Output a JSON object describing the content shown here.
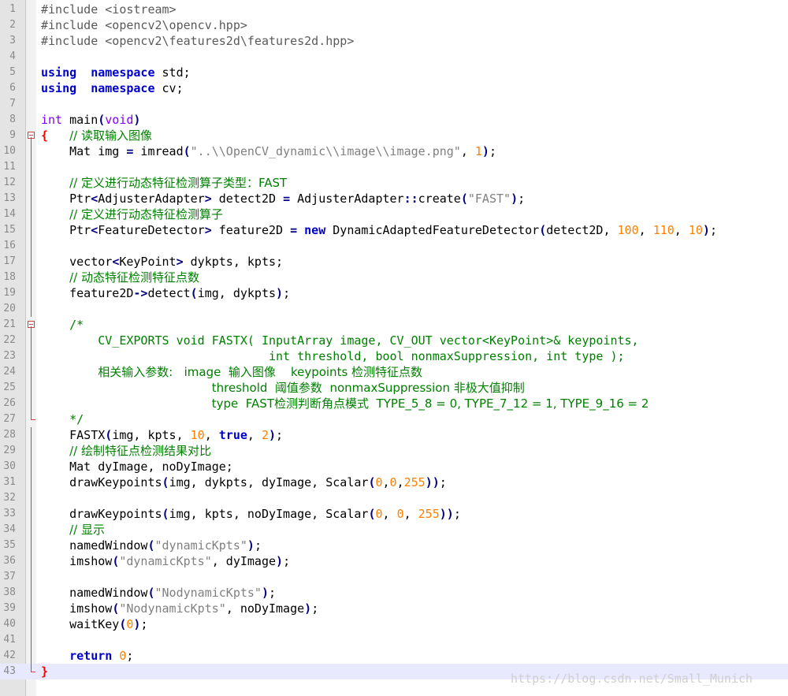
{
  "editor": {
    "watermark": "https://blog.csdn.net/Small_Munich",
    "lines": [
      {
        "n": "1",
        "t": [
          [
            "pp",
            "#include <iostream>"
          ]
        ]
      },
      {
        "n": "2",
        "t": [
          [
            "pp",
            "#include <opencv2\\opencv.hpp>"
          ]
        ]
      },
      {
        "n": "3",
        "t": [
          [
            "pp",
            "#include <opencv2\\features2d\\features2d.hpp>"
          ]
        ]
      },
      {
        "n": "4",
        "t": []
      },
      {
        "n": "5",
        "t": [
          [
            "kw",
            "using"
          ],
          [
            "",
            "  "
          ],
          [
            "kw",
            "namespace"
          ],
          [
            "",
            " std;"
          ]
        ]
      },
      {
        "n": "6",
        "t": [
          [
            "kw",
            "using"
          ],
          [
            "",
            "  "
          ],
          [
            "kw",
            "namespace"
          ],
          [
            "",
            " cv;"
          ]
        ]
      },
      {
        "n": "7",
        "t": []
      },
      {
        "n": "8",
        "t": [
          [
            "ty",
            "int"
          ],
          [
            "",
            " main"
          ],
          [
            "op",
            "("
          ],
          [
            "ty",
            "void"
          ],
          [
            "op",
            ")"
          ]
        ]
      },
      {
        "n": "9",
        "t": [
          [
            "br",
            "{"
          ],
          [
            "",
            "   "
          ],
          [
            "cm",
            "// 读取输入图像"
          ]
        ]
      },
      {
        "n": "10",
        "t": [
          [
            "",
            "    Mat img "
          ],
          [
            "op",
            "="
          ],
          [
            "",
            " imread"
          ],
          [
            "op",
            "("
          ],
          [
            "st",
            "\"..\\\\OpenCV_dynamic\\\\image\\\\image.png\""
          ],
          [
            "",
            ", "
          ],
          [
            "nm",
            "1"
          ],
          [
            "op",
            ")"
          ],
          [
            "",
            ";"
          ]
        ]
      },
      {
        "n": "11",
        "t": []
      },
      {
        "n": "12",
        "t": [
          [
            "",
            "    "
          ],
          [
            "cm",
            "// 定义进行动态特征检测算子类型：FAST"
          ]
        ]
      },
      {
        "n": "13",
        "t": [
          [
            "",
            "    Ptr"
          ],
          [
            "op",
            "<"
          ],
          [
            "",
            "AdjusterAdapter"
          ],
          [
            "op",
            ">"
          ],
          [
            "",
            " detect2D "
          ],
          [
            "op",
            "="
          ],
          [
            "",
            " AdjusterAdapter"
          ],
          [
            "op",
            "::"
          ],
          [
            "",
            "create"
          ],
          [
            "op",
            "("
          ],
          [
            "st",
            "\"FAST\""
          ],
          [
            "op",
            ")"
          ],
          [
            "",
            ";"
          ]
        ]
      },
      {
        "n": "14",
        "t": [
          [
            "",
            "    "
          ],
          [
            "cm",
            "// 定义进行动态特征检测算子"
          ]
        ]
      },
      {
        "n": "15",
        "t": [
          [
            "",
            "    Ptr"
          ],
          [
            "op",
            "<"
          ],
          [
            "",
            "FeatureDetector"
          ],
          [
            "op",
            ">"
          ],
          [
            "",
            " feature2D "
          ],
          [
            "op",
            "="
          ],
          [
            "",
            " "
          ],
          [
            "kw",
            "new"
          ],
          [
            "",
            " DynamicAdaptedFeatureDetector"
          ],
          [
            "op",
            "("
          ],
          [
            "",
            "detect2D, "
          ],
          [
            "nm",
            "100"
          ],
          [
            "",
            ", "
          ],
          [
            "nm",
            "110"
          ],
          [
            "",
            ", "
          ],
          [
            "nm",
            "10"
          ],
          [
            "op",
            ")"
          ],
          [
            "",
            ";"
          ]
        ]
      },
      {
        "n": "16",
        "t": []
      },
      {
        "n": "17",
        "t": [
          [
            "",
            "    vector"
          ],
          [
            "op",
            "<"
          ],
          [
            "",
            "KeyPoint"
          ],
          [
            "op",
            ">"
          ],
          [
            "",
            " dykpts, kpts;"
          ]
        ]
      },
      {
        "n": "18",
        "t": [
          [
            "",
            "    "
          ],
          [
            "cm",
            "// 动态特征检测特征点数"
          ]
        ]
      },
      {
        "n": "19",
        "t": [
          [
            "",
            "    feature2D"
          ],
          [
            "op",
            "->"
          ],
          [
            "",
            "detect"
          ],
          [
            "op",
            "("
          ],
          [
            "",
            "img, dykpts"
          ],
          [
            "op",
            ")"
          ],
          [
            "",
            ";"
          ]
        ]
      },
      {
        "n": "20",
        "t": []
      },
      {
        "n": "21",
        "t": [
          [
            "",
            "    "
          ],
          [
            "cm",
            "/*"
          ]
        ]
      },
      {
        "n": "22",
        "t": [
          [
            "",
            "        "
          ],
          [
            "cm",
            "CV_EXPORTS void FASTX( InputArray image, CV_OUT vector<KeyPoint>& keypoints,"
          ]
        ]
      },
      {
        "n": "23",
        "t": [
          [
            "",
            "                                "
          ],
          [
            "cm",
            "int threshold, bool nonmaxSuppression, int type );"
          ]
        ]
      },
      {
        "n": "24",
        "t": [
          [
            "",
            "        "
          ],
          [
            "cm",
            "相关输入参数:   image  输入图像    keypoints 检测特征点数"
          ]
        ]
      },
      {
        "n": "25",
        "t": [
          [
            "",
            "                        "
          ],
          [
            "cm",
            "threshold  阈值参数  nonmaxSuppression 非极大值抑制"
          ]
        ]
      },
      {
        "n": "26",
        "t": [
          [
            "",
            "                        "
          ],
          [
            "cm",
            "type  FAST检测判断角点模式  TYPE_5_8 = 0, TYPE_7_12 = 1, TYPE_9_16 = 2"
          ]
        ]
      },
      {
        "n": "27",
        "t": [
          [
            "",
            "    "
          ],
          [
            "cm",
            "*/"
          ]
        ]
      },
      {
        "n": "28",
        "t": [
          [
            "",
            "    FASTX"
          ],
          [
            "op",
            "("
          ],
          [
            "",
            "img, kpts, "
          ],
          [
            "nm",
            "10"
          ],
          [
            "",
            ", "
          ],
          [
            "kw",
            "true"
          ],
          [
            "",
            ", "
          ],
          [
            "nm",
            "2"
          ],
          [
            "op",
            ")"
          ],
          [
            "",
            ";"
          ]
        ]
      },
      {
        "n": "29",
        "t": [
          [
            "",
            "    "
          ],
          [
            "cm",
            "// 绘制特征点检测结果对比"
          ]
        ]
      },
      {
        "n": "30",
        "t": [
          [
            "",
            "    Mat dyImage, noDyImage;"
          ]
        ]
      },
      {
        "n": "31",
        "t": [
          [
            "",
            "    drawKeypoints"
          ],
          [
            "op",
            "("
          ],
          [
            "",
            "img, dykpts, dyImage, Scalar"
          ],
          [
            "op",
            "("
          ],
          [
            "nm",
            "0"
          ],
          [
            "",
            ","
          ],
          [
            "nm",
            "0"
          ],
          [
            "",
            ","
          ],
          [
            "nm",
            "255"
          ],
          [
            "op",
            "))"
          ],
          [
            "",
            ";"
          ]
        ]
      },
      {
        "n": "32",
        "t": []
      },
      {
        "n": "33",
        "t": [
          [
            "",
            "    drawKeypoints"
          ],
          [
            "op",
            "("
          ],
          [
            "",
            "img, kpts, noDyImage, Scalar"
          ],
          [
            "op",
            "("
          ],
          [
            "nm",
            "0"
          ],
          [
            "",
            ", "
          ],
          [
            "nm",
            "0"
          ],
          [
            "",
            ", "
          ],
          [
            "nm",
            "255"
          ],
          [
            "op",
            "))"
          ],
          [
            "",
            ";"
          ]
        ]
      },
      {
        "n": "34",
        "t": [
          [
            "",
            "    "
          ],
          [
            "cm",
            "// 显示"
          ]
        ]
      },
      {
        "n": "35",
        "t": [
          [
            "",
            "    namedWindow"
          ],
          [
            "op",
            "("
          ],
          [
            "st",
            "\"dynamicKpts\""
          ],
          [
            "op",
            ")"
          ],
          [
            "",
            ";"
          ]
        ]
      },
      {
        "n": "36",
        "t": [
          [
            "",
            "    imshow"
          ],
          [
            "op",
            "("
          ],
          [
            "st",
            "\"dynamicKpts\""
          ],
          [
            "",
            ", dyImage"
          ],
          [
            "op",
            ")"
          ],
          [
            "",
            ";"
          ]
        ]
      },
      {
        "n": "37",
        "t": []
      },
      {
        "n": "38",
        "t": [
          [
            "",
            "    namedWindow"
          ],
          [
            "op",
            "("
          ],
          [
            "st",
            "\"NodynamicKpts\""
          ],
          [
            "op",
            ")"
          ],
          [
            "",
            ";"
          ]
        ]
      },
      {
        "n": "39",
        "t": [
          [
            "",
            "    imshow"
          ],
          [
            "op",
            "("
          ],
          [
            "st",
            "\"NodynamicKpts\""
          ],
          [
            "",
            ", noDyImage"
          ],
          [
            "op",
            ")"
          ],
          [
            "",
            ";"
          ]
        ]
      },
      {
        "n": "40",
        "t": [
          [
            "",
            "    waitKey"
          ],
          [
            "op",
            "("
          ],
          [
            "nm",
            "0"
          ],
          [
            "op",
            ")"
          ],
          [
            "",
            ";"
          ]
        ]
      },
      {
        "n": "41",
        "t": []
      },
      {
        "n": "42",
        "t": [
          [
            "",
            "    "
          ],
          [
            "kw",
            "return"
          ],
          [
            "",
            " "
          ],
          [
            "nm",
            "0"
          ],
          [
            "",
            ";"
          ]
        ]
      },
      {
        "n": "43",
        "t": [
          [
            "br",
            "}"
          ]
        ]
      }
    ]
  }
}
